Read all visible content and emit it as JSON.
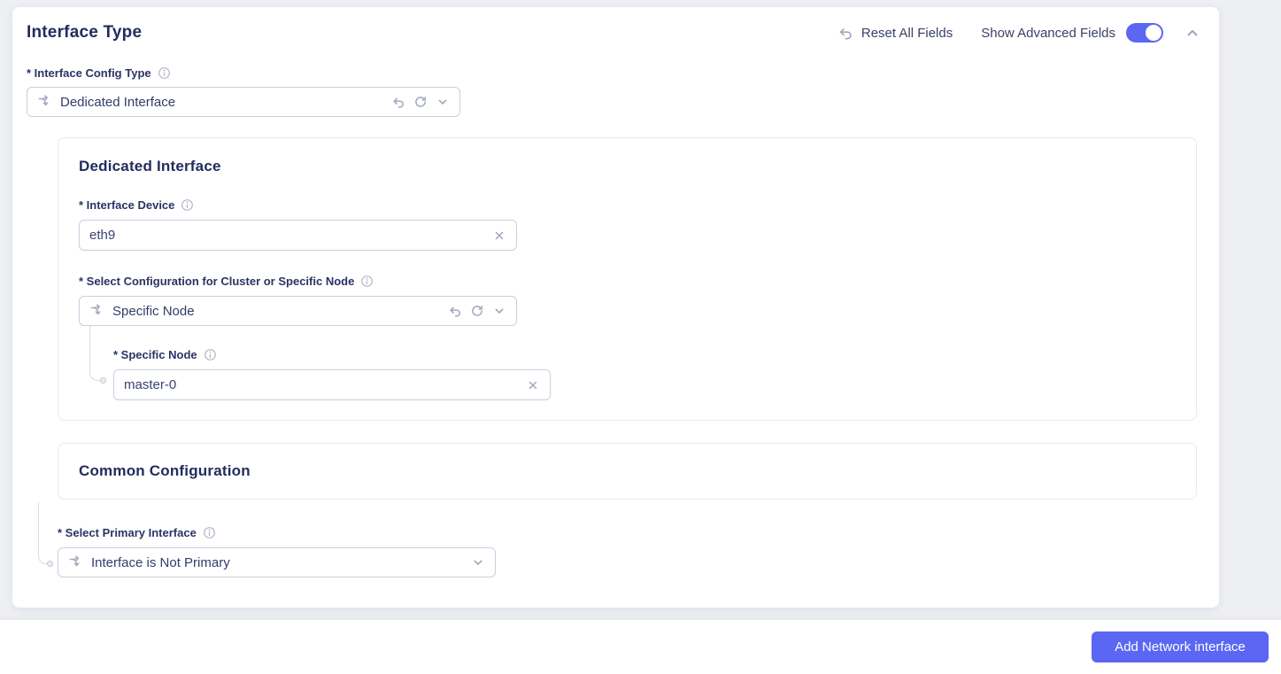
{
  "colors": {
    "accent": "#5b67f2",
    "page_bg": "#edeff3",
    "heading_text": "#222c5e",
    "label_text": "#2b3364",
    "icon_gray": "#a6adc0",
    "input_border": "#c9cfdf",
    "card_border": "#e6e9f1"
  },
  "header": {
    "title": "Interface Type",
    "reset_all_label": "Reset All Fields",
    "advanced_label": "Show Advanced Fields",
    "advanced_on": true
  },
  "interface_config_type": {
    "label": "* Interface Config Type",
    "value": "Dedicated Interface"
  },
  "dedicated_section": {
    "title": "Dedicated Interface",
    "interface_device": {
      "label": "* Interface Device",
      "value": "eth9"
    },
    "cluster_config": {
      "label": "* Select Configuration for Cluster or Specific Node",
      "value": "Specific Node"
    },
    "specific_node": {
      "label": "* Specific Node",
      "value": "master-0"
    }
  },
  "common_section": {
    "title": "Common Configuration",
    "primary_interface": {
      "label": "* Select Primary Interface",
      "value": "Interface is Not Primary"
    }
  },
  "footer": {
    "add_button": "Add Network interface"
  },
  "icons": {
    "header_reset": "undo-arrow-icon",
    "header_collapse": "chevron-up-icon",
    "label_info": "info-circle-icon",
    "select_type": "branch-split-icon",
    "select_reset": "undo-arrow-icon",
    "select_refresh": "refresh-icon",
    "select_open": "chevron-down-icon",
    "input_clear": "close-x-icon",
    "toggle": "switch-on"
  }
}
